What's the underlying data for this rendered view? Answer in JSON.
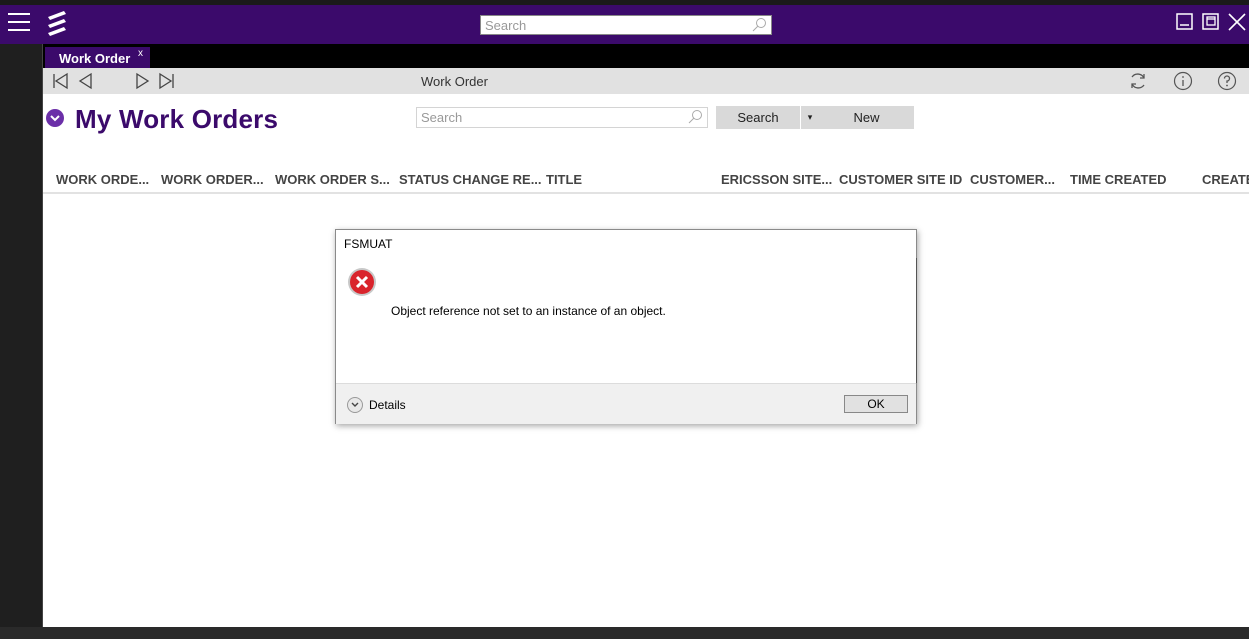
{
  "topbar": {
    "search_placeholder": "Search",
    "accent": "#3b0a6b"
  },
  "tab": {
    "label": "Work Order",
    "close": "x"
  },
  "nav": {
    "breadcrumb": "Work Order"
  },
  "page": {
    "title": "My Work Orders",
    "search_placeholder": "Search",
    "search_button": "Search",
    "dropdown_arrow": "▾",
    "new_button": "New"
  },
  "columns": [
    "WORK ORDE...",
    "WORK ORDER...",
    "WORK ORDER S...",
    "STATUS CHANGE RE...",
    "TITLE",
    "ERICSSON SITE...",
    "CUSTOMER SITE ID",
    "CUSTOMER...",
    "TIME CREATED",
    "CREATED"
  ],
  "dialog": {
    "title": "FSMUAT",
    "message": "Object reference not set to an instance of an object.",
    "details_label": "Details",
    "ok_label": "OK"
  }
}
